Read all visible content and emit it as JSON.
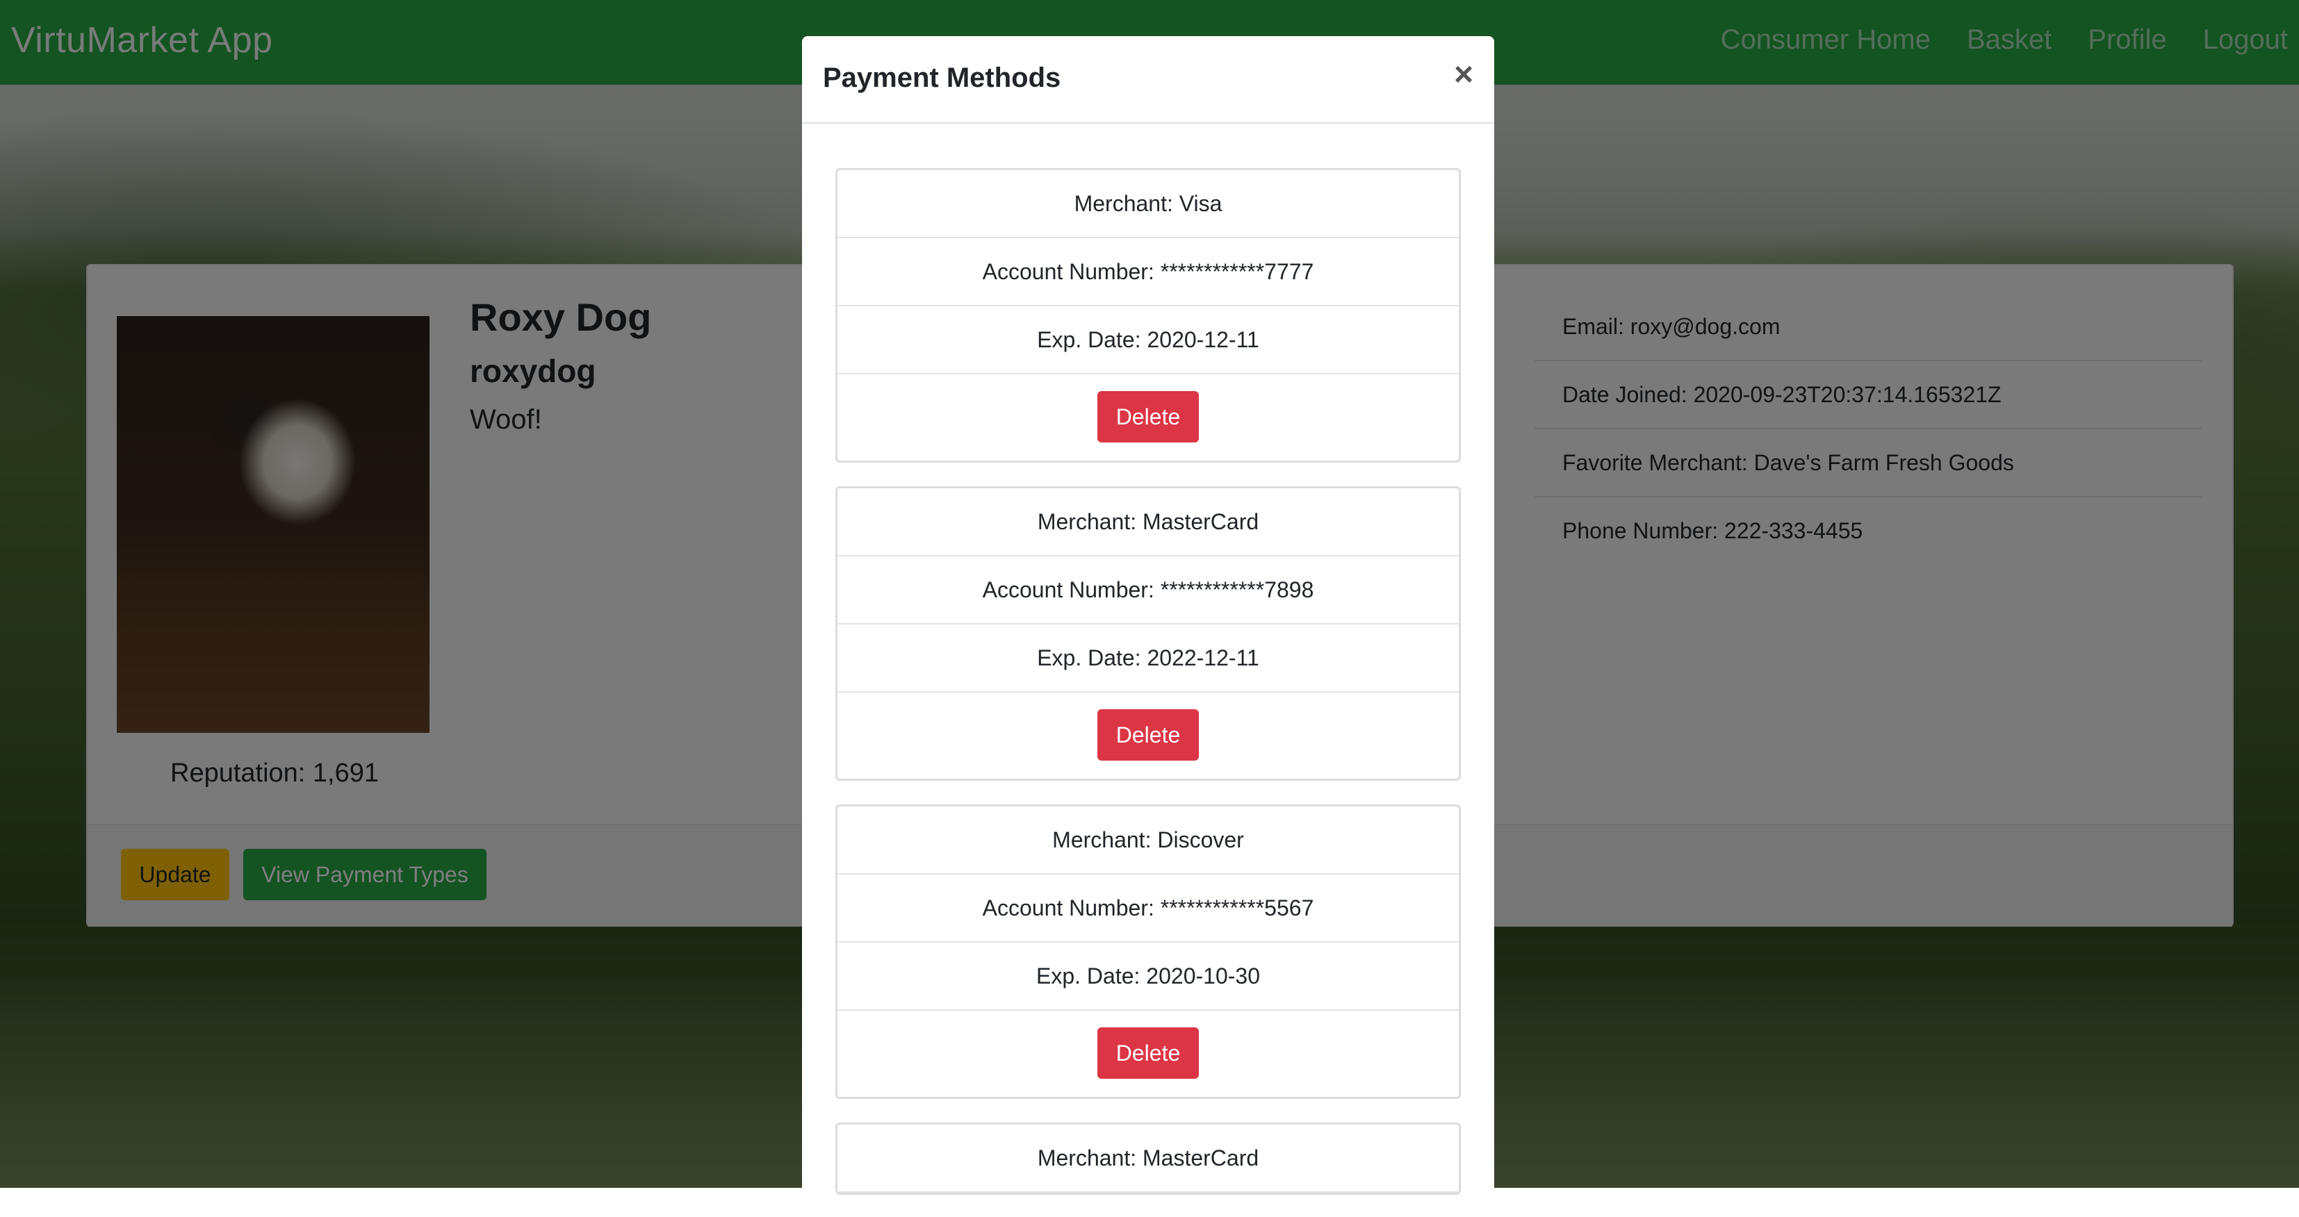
{
  "navbar": {
    "brand": "VirtuMarket App",
    "links": [
      "Consumer Home",
      "Basket",
      "Profile",
      "Logout"
    ]
  },
  "profile": {
    "name": "Roxy Dog",
    "username": "roxydog",
    "bio": "Woof!",
    "reputation": "Reputation: 1,691",
    "info": [
      "Email: roxy@dog.com",
      "Date Joined: 2020-09-23T20:37:14.165321Z",
      "Favorite Merchant: Dave's Farm Fresh Goods",
      "Phone Number: 222-333-4455"
    ],
    "buttons": {
      "update": "Update",
      "view_payment_types": "View Payment Types"
    }
  },
  "modal": {
    "title": "Payment Methods",
    "close": "×",
    "delete_label": "Delete",
    "payment_methods": [
      {
        "merchant": "Merchant: Visa",
        "account": "Account Number: ************7777",
        "exp": "Exp. Date: 2020-12-11"
      },
      {
        "merchant": "Merchant: MasterCard",
        "account": "Account Number: ************7898",
        "exp": "Exp. Date: 2022-12-11"
      },
      {
        "merchant": "Merchant: Discover",
        "account": "Account Number: ************5567",
        "exp": "Exp. Date: 2020-10-30"
      },
      {
        "merchant": "Merchant: MasterCard"
      }
    ]
  },
  "colors": {
    "navbar": "#28a745",
    "update_button": "#ffc107",
    "view_button": "#28a745",
    "delete_button": "#dc3545"
  }
}
